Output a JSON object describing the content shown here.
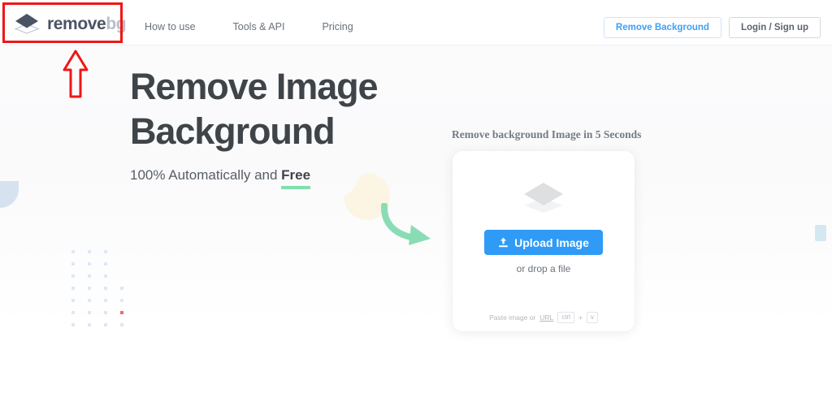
{
  "header": {
    "logo": {
      "icon": "stacked-layers-icon",
      "text_primary": "remove",
      "text_secondary": "bg"
    },
    "nav": [
      {
        "label": "How to use"
      },
      {
        "label": "Tools & API"
      },
      {
        "label": "Pricing"
      }
    ],
    "actions": {
      "remove_background": "Remove Background",
      "login_signup": "Login / Sign up"
    }
  },
  "hero": {
    "title_line1": "Remove Image",
    "title_line2": "Background",
    "subtitle_prefix": "100% Automatically and ",
    "subtitle_highlight": "Free"
  },
  "upload": {
    "heading": "Remove background Image in 5 Seconds",
    "placeholder_icon": "stacked-layers-icon",
    "button_icon": "upload-tray-icon",
    "button_label": "Upload Image",
    "drop_text": "or drop a file",
    "paste_text": "Paste image or",
    "paste_link": "URL",
    "key_modifier": "ctrl",
    "key_plus": "+",
    "key_letter": "v"
  },
  "annotation": {
    "highlight_target": "logo",
    "color": "#f01616"
  },
  "colors": {
    "accent_blue": "#2f9bf7",
    "link_blue": "#3ea0f7",
    "highlight_green": "#7fe0ab",
    "logo_dark": "#4a5464",
    "logo_light": "#b9bec7",
    "heading_dark": "#3f4449",
    "annotation_red": "#f01616",
    "blob_cream": "#fdf6e6",
    "deco_blue": "#d7e2f0"
  }
}
